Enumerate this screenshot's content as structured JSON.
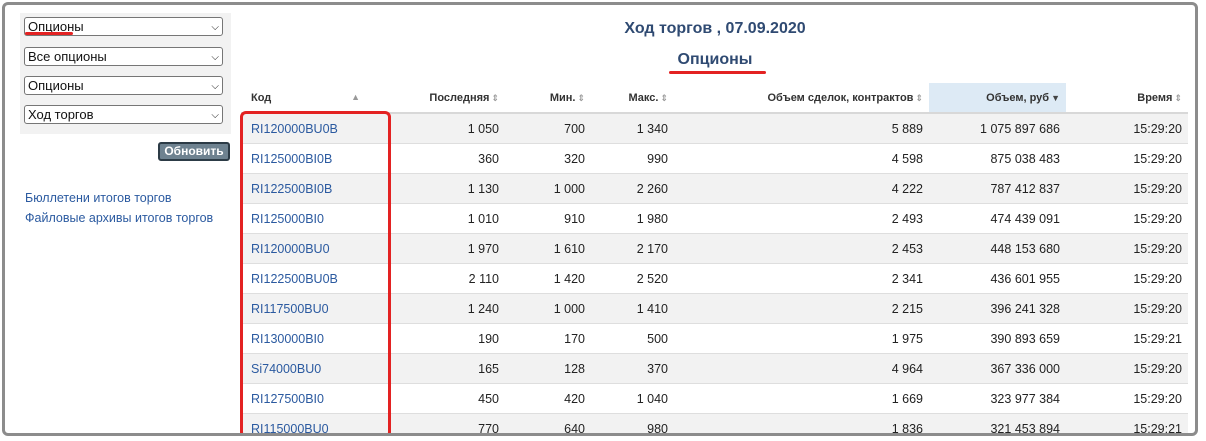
{
  "filters": {
    "selects": [
      "Опционы",
      "Все опционы",
      "Опционы",
      "Ход торгов"
    ],
    "refresh_label": "Обновить"
  },
  "links": [
    "Бюллетени итогов торгов",
    "Файловые архивы итогов торгов"
  ],
  "header": {
    "title": "Ход торгов , 07.09.2020",
    "subtitle": "Опционы"
  },
  "table": {
    "columns": [
      "Код",
      "Последняя",
      "Мин.",
      "Макс.",
      "Объем сделок, контрактов",
      "Объем, руб",
      "Время"
    ],
    "rows": [
      [
        "RI120000BU0B",
        "1 050",
        "700",
        "1 340",
        "5 889",
        "1 075 897 686",
        "15:29:20"
      ],
      [
        "RI125000BI0B",
        "360",
        "320",
        "990",
        "4 598",
        "875 038 483",
        "15:29:20"
      ],
      [
        "RI122500BI0B",
        "1 130",
        "1 000",
        "2 260",
        "4 222",
        "787 412 837",
        "15:29:20"
      ],
      [
        "RI125000BI0",
        "1 010",
        "910",
        "1 980",
        "2 493",
        "474 439 091",
        "15:29:20"
      ],
      [
        "RI120000BU0",
        "1 970",
        "1 610",
        "2 170",
        "2 453",
        "448 153 680",
        "15:29:20"
      ],
      [
        "RI122500BU0B",
        "2 110",
        "1 420",
        "2 520",
        "2 341",
        "436 601 955",
        "15:29:20"
      ],
      [
        "RI117500BU0",
        "1 240",
        "1 000",
        "1 410",
        "2 215",
        "396 241 328",
        "15:29:20"
      ],
      [
        "RI130000BI0",
        "190",
        "170",
        "500",
        "1 975",
        "390 893 659",
        "15:29:21"
      ],
      [
        "Si74000BU0",
        "165",
        "128",
        "370",
        "4 964",
        "367 336 000",
        "15:29:20"
      ],
      [
        "RI127500BI0",
        "450",
        "420",
        "1 040",
        "1 669",
        "323 977 384",
        "15:29:20"
      ],
      [
        "RI115000BU0",
        "770",
        "640",
        "980",
        "1 836",
        "321 453 894",
        "15:29:21"
      ]
    ]
  },
  "colors": {
    "accent_red": "#e32222",
    "link_blue": "#2b5aa0",
    "title_blue": "#2f4a72",
    "sorted_header_bg": "#ddeaf5"
  }
}
